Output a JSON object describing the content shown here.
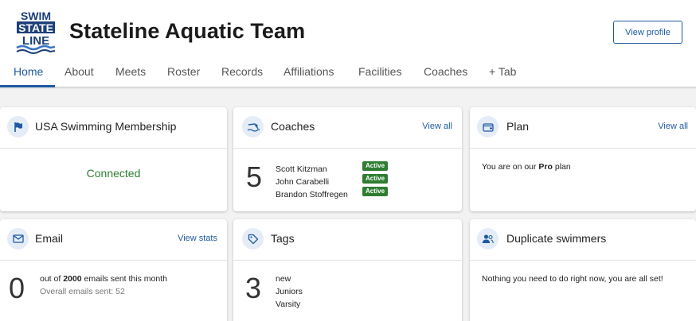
{
  "header": {
    "logo_text": [
      "SWIM",
      "STATE",
      "LINE"
    ],
    "team_name": "Stateline Aquatic Team",
    "view_profile_label": "View profile"
  },
  "tabs": [
    {
      "label": "Home",
      "active": true
    },
    {
      "label": "About"
    },
    {
      "label": "Meets"
    },
    {
      "label": "Roster"
    },
    {
      "label": "Records"
    },
    {
      "label": "Affiliations"
    },
    {
      "label": "Facilities"
    },
    {
      "label": "Coaches"
    },
    {
      "label": "+ Tab"
    }
  ],
  "cards": {
    "usa": {
      "title": "USA Swimming Membership",
      "icon": "flag-icon",
      "status": "Connected"
    },
    "coaches": {
      "title": "Coaches",
      "icon": "swimmer-icon",
      "link": "View all",
      "count": "5",
      "list": [
        {
          "name": "Scott Kitzman",
          "status": "Active"
        },
        {
          "name": "John Carabelli",
          "status": "Active"
        },
        {
          "name": "Brandon Stoffregen",
          "status": "Active"
        }
      ]
    },
    "plan": {
      "title": "Plan",
      "icon": "wallet-icon",
      "link": "View all",
      "text_before": "You are on our ",
      "plan_name": "Pro",
      "text_after": " plan"
    },
    "email": {
      "title": "Email",
      "icon": "mail-icon",
      "link": "View stats",
      "count": "0",
      "line_before": "out of ",
      "quota": "2000",
      "line_after": " emails sent this month",
      "overall": "Overall emails sent: 52"
    },
    "tags": {
      "title": "Tags",
      "icon": "tag-icon",
      "count": "3",
      "list": [
        "new",
        "Juniors",
        "Varsity"
      ]
    },
    "duplicates": {
      "title": "Duplicate swimmers",
      "icon": "people-icon",
      "message": "Nothing you need to do right now, you are all set!"
    }
  },
  "colors": {
    "accent": "#1f5aa0",
    "success": "#2e7d32",
    "background": "#f2f2f2",
    "icon_bg": "#e4ecf7"
  }
}
